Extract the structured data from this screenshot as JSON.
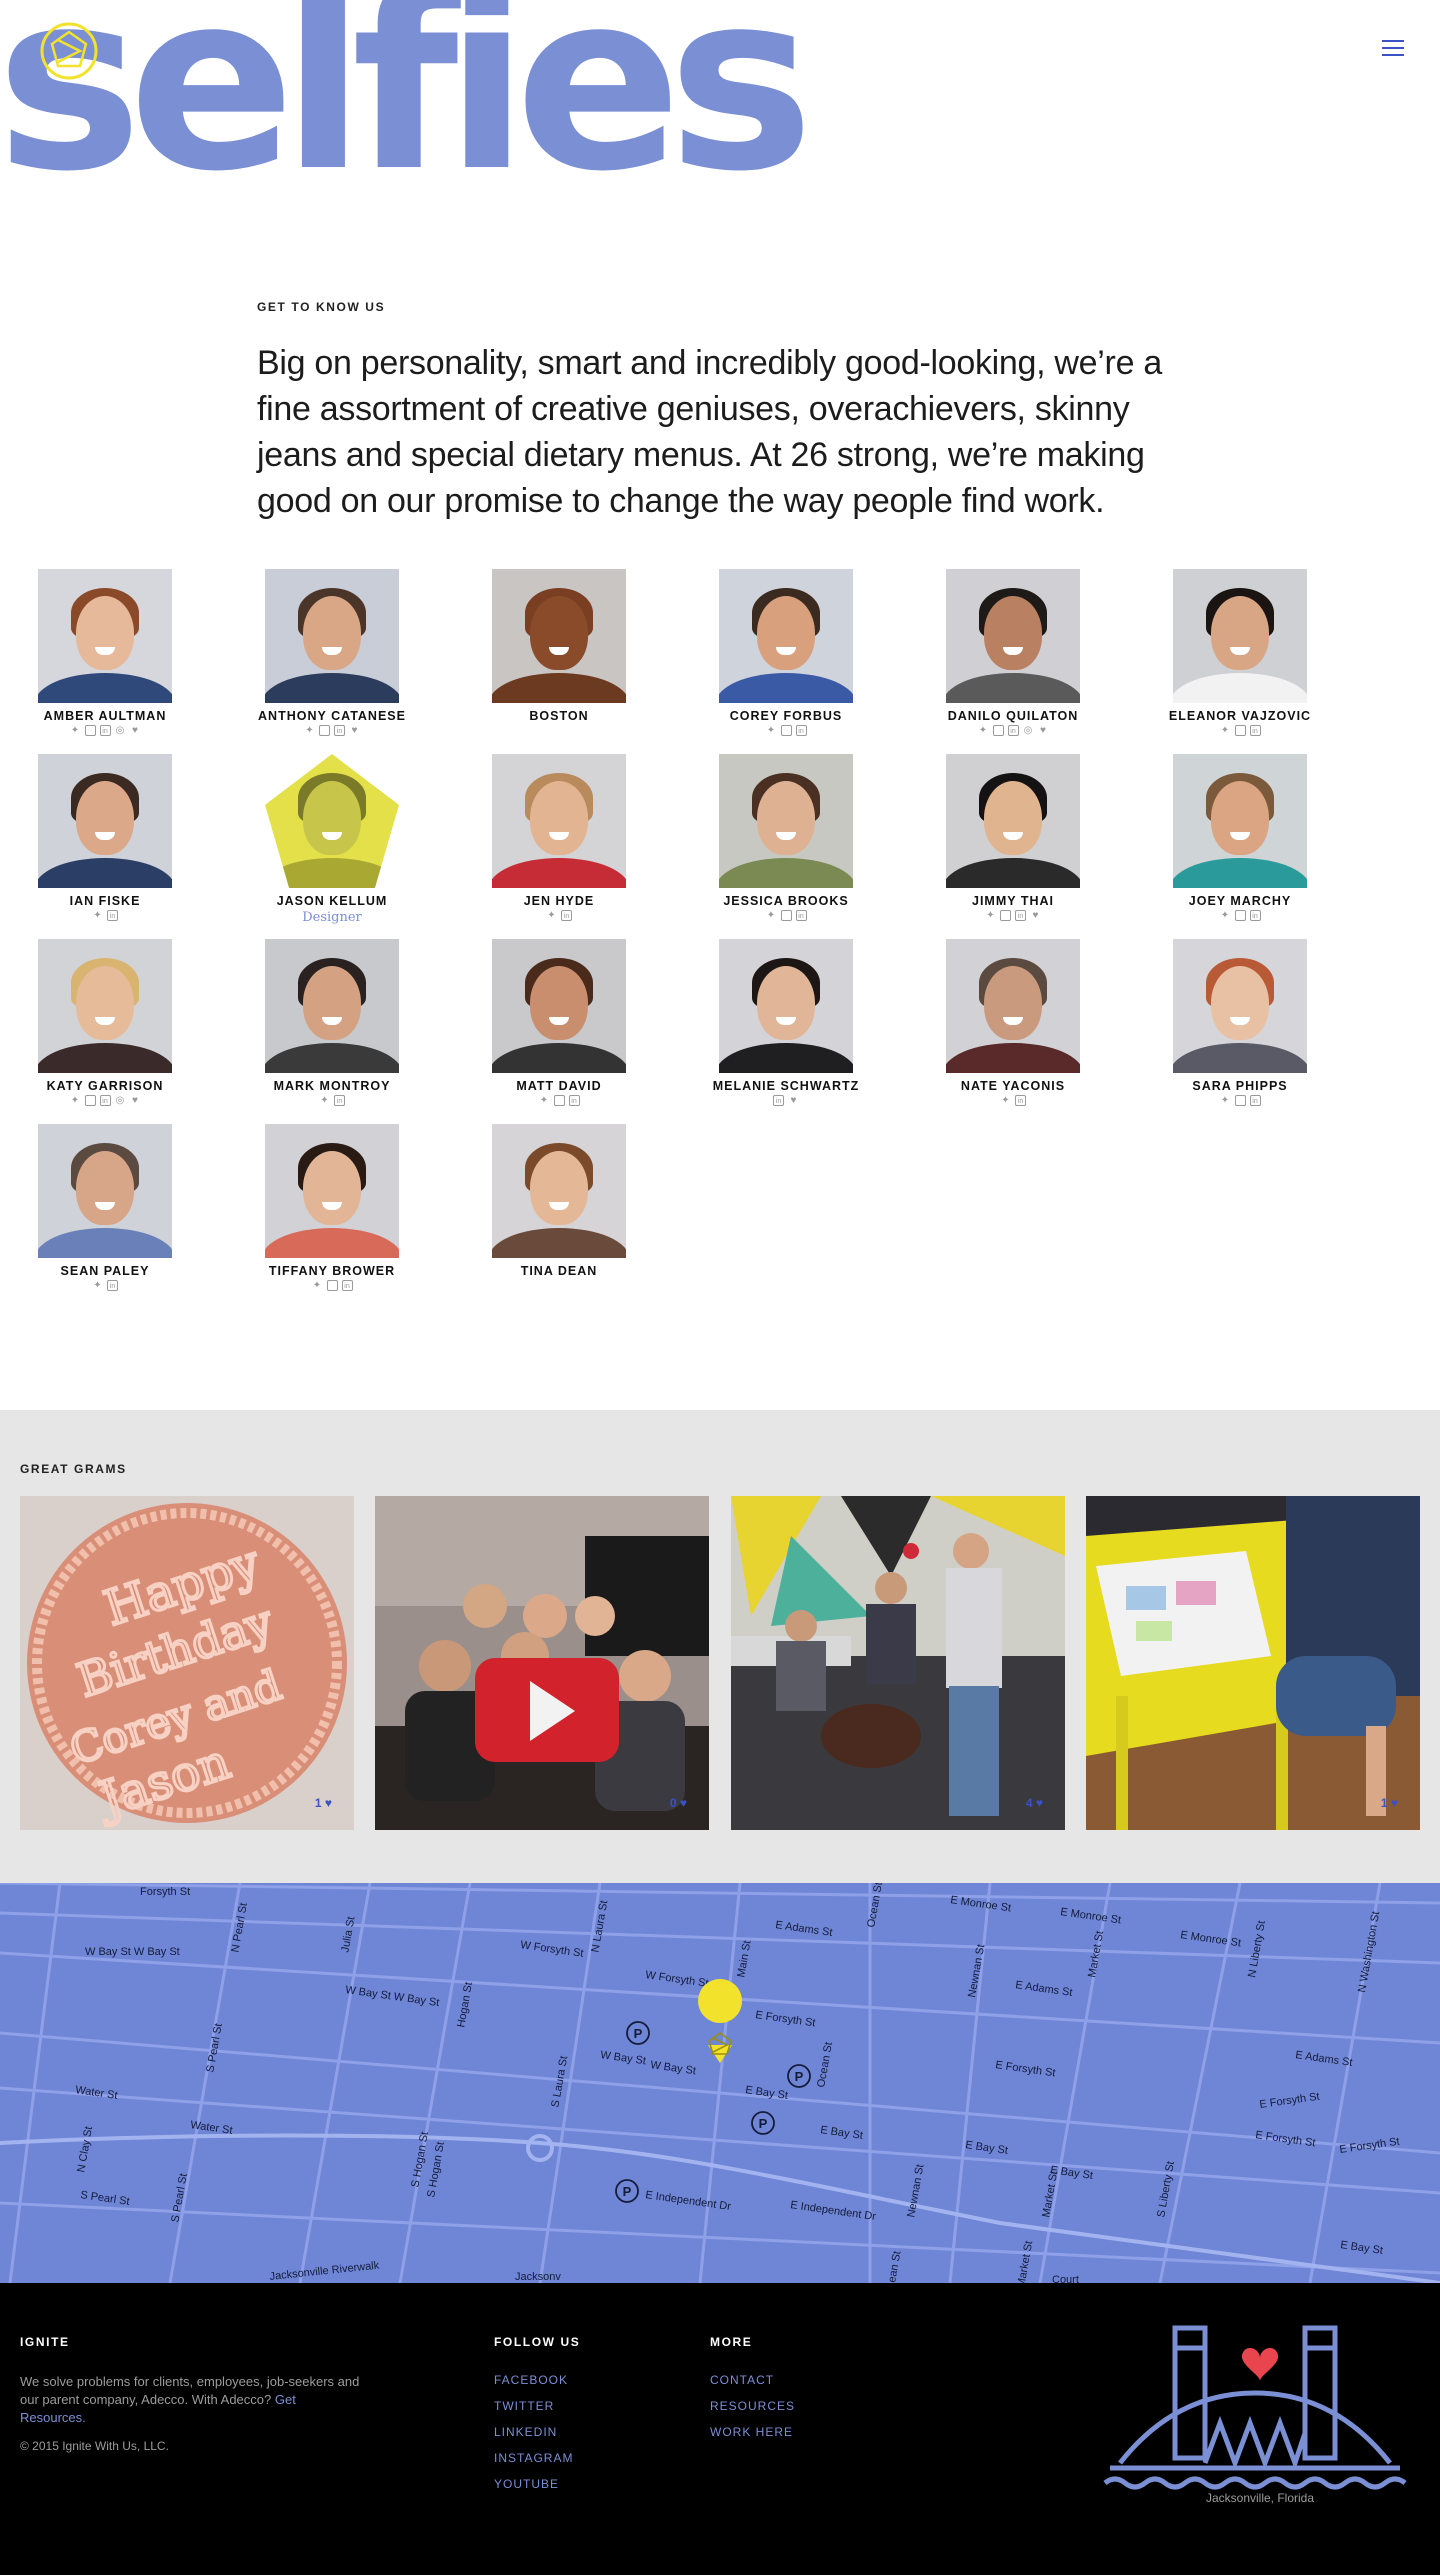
{
  "hero": {
    "word": "selfies"
  },
  "intro": {
    "eyebrow": "GET TO KNOW US",
    "text": "Big on personality, smart and incredibly good-looking, we’re a fine assortment of creative geniuses, overachievers, skinny jeans and special dietary menus. At 26 strong, we’re making good on our promise to change the way people find work."
  },
  "team": [
    {
      "name": "AMBER AULTMAN",
      "socials": [
        "twitter",
        "instagram",
        "linkedin",
        "dribbble",
        "heart"
      ],
      "skin": "#e6b99a",
      "hair": "#8a4a2a",
      "shirt": "#2f4a7a",
      "bg": "#d5d7dc"
    },
    {
      "name": "ANTHONY CATANESE",
      "socials": [
        "twitter",
        "instagram",
        "linkedin",
        "heart"
      ],
      "skin": "#d9a686",
      "hair": "#4a3528",
      "shirt": "#2c3c5c",
      "bg": "#c8cdd8"
    },
    {
      "name": "BOSTON",
      "socials": [],
      "skin": "#8a4b2a",
      "hair": "#7a3f22",
      "shirt": "#6b3a20",
      "bg": "#c9c5c2"
    },
    {
      "name": "COREY FORBUS",
      "socials": [
        "twitter",
        "instagram",
        "linkedin"
      ],
      "skin": "#d8a07c",
      "hair": "#3a2a20",
      "shirt": "#3b5aa6",
      "bg": "#cfd3db"
    },
    {
      "name": "DANILO QUILATON",
      "socials": [
        "twitter",
        "instagram",
        "linkedin",
        "dribbble",
        "heart"
      ],
      "skin": "#b98162",
      "hair": "#1e1a18",
      "shirt": "#5a5a5a",
      "bg": "#d0d0d4"
    },
    {
      "name": "ELEANOR VAJZOVIC",
      "socials": [
        "twitter",
        "instagram",
        "linkedin"
      ],
      "skin": "#d8a684",
      "hair": "#1a1412",
      "shirt": "#f2f2f2",
      "bg": "#cfd0d4"
    },
    {
      "name": "IAN FISKE",
      "socials": [
        "twitter",
        "linkedin"
      ],
      "skin": "#dba98a",
      "hair": "#3a2a22",
      "shirt": "#2b3e66",
      "bg": "#cfd2d8"
    },
    {
      "name": "JASON KELLUM",
      "role": "Designer",
      "socials": [],
      "skin": "#c8c64a",
      "hair": "#7a7a28",
      "shirt": "#a8a832",
      "bg": "#e3e04a",
      "pentagon": true
    },
    {
      "name": "JEN HYDE",
      "socials": [
        "twitter",
        "linkedin"
      ],
      "skin": "#e2b491",
      "hair": "#b88a5c",
      "shirt": "#c62c35",
      "bg": "#d4d4d6"
    },
    {
      "name": "JESSICA BROOKS",
      "socials": [
        "twitter",
        "instagram",
        "linkedin"
      ],
      "skin": "#deb193",
      "hair": "#4a3022",
      "shirt": "#7a8a52",
      "bg": "#c8c8c2"
    },
    {
      "name": "JIMMY THAI",
      "socials": [
        "twitter",
        "instagram",
        "linkedin",
        "heart"
      ],
      "skin": "#e0b48e",
      "hair": "#141212",
      "shirt": "#2a2a2a",
      "bg": "#d0d0d2"
    },
    {
      "name": "JOEY MARCHY",
      "socials": [
        "twitter",
        "instagram",
        "linkedin"
      ],
      "skin": "#dba583",
      "hair": "#7a5a3a",
      "shirt": "#2a9a9a",
      "bg": "#cfd4d6"
    },
    {
      "name": "KATY GARRISON",
      "socials": [
        "twitter",
        "instagram",
        "linkedin",
        "dribbble",
        "heart"
      ],
      "skin": "#e6bb9a",
      "hair": "#d8b470",
      "shirt": "#3a2a2a",
      "bg": "#d2d3d6"
    },
    {
      "name": "MARK MONTROY",
      "socials": [
        "twitter",
        "linkedin"
      ],
      "skin": "#d4a283",
      "hair": "#2a2220",
      "shirt": "#3a3a3a",
      "bg": "#c8c9cd"
    },
    {
      "name": "MATT DAVID",
      "socials": [
        "twitter",
        "instagram",
        "linkedin"
      ],
      "skin": "#c98e6e",
      "hair": "#4a2a1a",
      "shirt": "#333333",
      "bg": "#c9c9cc"
    },
    {
      "name": "MELANIE SCHWARTZ",
      "socials": [
        "linkedin",
        "heart"
      ],
      "skin": "#e1b698",
      "hair": "#1c1614",
      "shirt": "#1f1f22",
      "bg": "#d4d4d8"
    },
    {
      "name": "NATE YACONIS",
      "socials": [
        "twitter",
        "linkedin"
      ],
      "skin": "#c99a7e",
      "hair": "#5a4a40",
      "shirt": "#5a2a2a",
      "bg": "#d2d2d6"
    },
    {
      "name": "SARA PHIPPS",
      "socials": [
        "twitter",
        "instagram",
        "linkedin"
      ],
      "skin": "#e8c0a4",
      "hair": "#b85a36",
      "shirt": "#5a5a66",
      "bg": "#d6d6da"
    },
    {
      "name": "SEAN PALEY",
      "socials": [
        "twitter",
        "linkedin"
      ],
      "skin": "#d7a587",
      "hair": "#5a4a40",
      "shirt": "#6a80b8",
      "bg": "#cfd2d8"
    },
    {
      "name": "TIFFANY BROWER",
      "socials": [
        "twitter",
        "instagram",
        "linkedin"
      ],
      "skin": "#e2b597",
      "hair": "#2a1a14",
      "shirt": "#d86a5a",
      "bg": "#d2d2d6"
    },
    {
      "name": "TINA DEAN",
      "socials": [],
      "skin": "#e4b896",
      "hair": "#7a4a2a",
      "shirt": "#6a4a3a",
      "bg": "#d6d4d6"
    }
  ],
  "grams": {
    "title": "GREAT GRAMS",
    "items": [
      {
        "alt": "birthday cake",
        "likes": "1",
        "cake_text": "Happy Birthday Corey and Jason"
      },
      {
        "alt": "team with play button",
        "likes": "0"
      },
      {
        "alt": "office with dog",
        "likes": "4"
      },
      {
        "alt": "yellow desk magazine",
        "likes": "1"
      }
    ]
  },
  "map": {
    "streets": [
      "Forsyth St",
      "W Bay St W Bay St",
      "N Pearl St",
      "Julia St",
      "W Forsyth St",
      "N Laura St",
      "W Forsyth St",
      "E Adams St",
      "Main St",
      "Ocean St",
      "E Monroe St",
      "E Monroe St",
      "E Monroe St",
      "N Liberty St",
      "N Washington St",
      "Newnan St",
      "Market St",
      "E Forsyth St",
      "E Adams St",
      "W Bay St W Bay St",
      "Hogan St",
      "E Forsyth St",
      "Ocean St",
      "W Bay St",
      "W Bay St",
      "E Bay St",
      "E Forsyth St",
      "E Adams St",
      "Water St",
      "S Pearl St",
      "S Laura St",
      "E Bay St",
      "E Bay St",
      "E Forsyth St",
      "E Forsyth St",
      "E Bay St",
      "N Clay St",
      "Water St",
      "S Hogan St",
      "S Hogan St",
      "E Independent Dr",
      "E Independent Dr",
      "Newnan St",
      "Market St",
      "S Liberty St",
      "E Bay St",
      "S Pearl St",
      "S Pearl St",
      "Jacksonville Riverwalk",
      "Jacksonv",
      "ean St",
      "Market St",
      "Court"
    ]
  },
  "footer": {
    "ignite_title": "IGNITE",
    "ignite_text": "We solve problems for clients, employees, job-seekers and our parent company, Adecco. With Adecco?",
    "ignite_link": "Get Resources.",
    "copyright": "© 2015 Ignite With Us, LLC.",
    "follow_title": "FOLLOW US",
    "follow_links": [
      "FACEBOOK",
      "TWITTER",
      "LINKEDIN",
      "INSTAGRAM",
      "YOUTUBE"
    ],
    "more_title": "MORE",
    "more_links": [
      "CONTACT",
      "RESOURCES",
      "WORK HERE"
    ],
    "city": "Jacksonville, Florida"
  },
  "colors": {
    "accent": "#7b8fd4",
    "brand_blue": "#3a52c6",
    "yellow": "#f2e22b",
    "heart": "#e8454f"
  }
}
